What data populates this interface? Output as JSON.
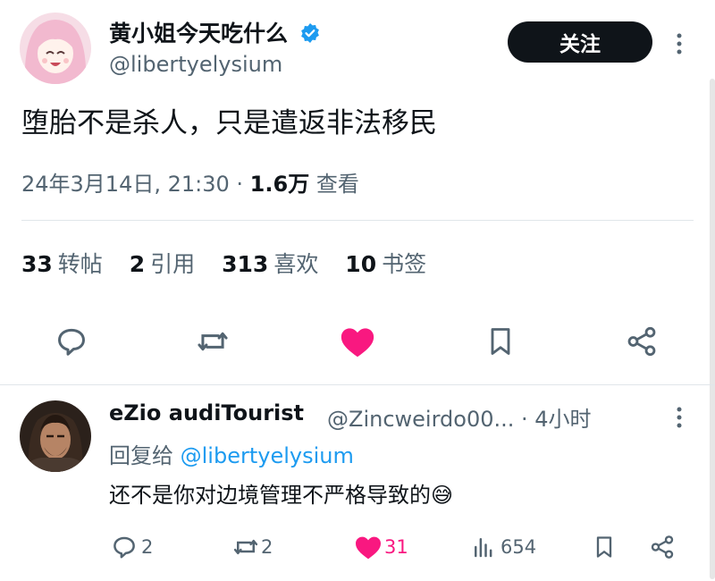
{
  "tweet": {
    "display_name": "黄小姐今天吃什么",
    "handle": "@libertyelysium",
    "follow_label": "关注",
    "text": "堕胎不是杀人，只是遣返非法移民",
    "date": "24年3月14日, 21:30",
    "separator": " · ",
    "views_count": "1.6万",
    "views_label": "查看",
    "stats": [
      {
        "count": "33",
        "label": "转帖"
      },
      {
        "count": "2",
        "label": "引用"
      },
      {
        "count": "313",
        "label": "喜欢"
      },
      {
        "count": "10",
        "label": "书签"
      }
    ],
    "liked_color": "#f91880",
    "verified_color": "#1d9bf0"
  },
  "reply": {
    "display_name": "eZio audiTourist",
    "handle_time": "@Zincweirdo00... · 4小时",
    "replying_prefix": "回复给",
    "replying_to": "@libertyelysium",
    "text": "还不是你对边境管理不严格导致的😅",
    "reply_count": "2",
    "retweet_count": "2",
    "like_count": "31",
    "view_count": "654"
  }
}
